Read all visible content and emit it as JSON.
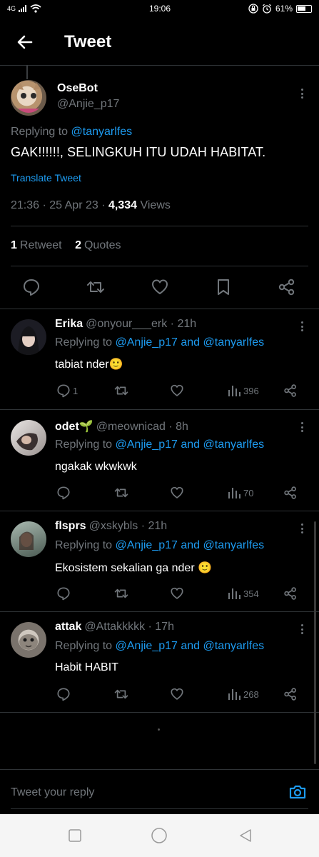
{
  "status": {
    "network": "4G",
    "time": "19:06",
    "battery": "61%"
  },
  "header": {
    "title": "Tweet"
  },
  "main_tweet": {
    "name": "OseBot",
    "handle": "@Anjie_p17",
    "replying_prefix": "Replying to ",
    "replying_to": "@tanyarlfes",
    "text": "GAK!!!!!!, SELINGKUH ITU UDAH HABITAT.",
    "translate": "Translate Tweet",
    "time": "21:36 · 25 Apr 23 · ",
    "views_count": "4,334",
    "views_label": " Views",
    "retweets_count": "1",
    "retweets_label": "Retweet",
    "quotes_count": "2",
    "quotes_label": "Quotes"
  },
  "replies": [
    {
      "name": "Erika",
      "handle": "@onyour___erk · 21h",
      "replying_prefix": "Replying to ",
      "replying_to": "@Anjie_p17 and @tanyarlfes",
      "text": "tabiat nder🙂",
      "reply_count": "1",
      "views": "396"
    },
    {
      "name": "odet🌱",
      "handle": "@meownicad · 8h",
      "replying_prefix": "Replying to ",
      "replying_to": "@Anjie_p17 and @tanyarlfes",
      "text": "ngakak wkwkwk",
      "reply_count": "",
      "views": "70"
    },
    {
      "name": "flsprs",
      "handle": "@xskybls · 21h",
      "replying_prefix": "Replying to ",
      "replying_to": "@Anjie_p17 and @tanyarlfes",
      "text": "Ekosistem sekalian ga nder 🙂",
      "reply_count": "",
      "views": "354"
    },
    {
      "name": "attak",
      "handle": "@Attakkkkk · 17h",
      "replying_prefix": "Replying to ",
      "replying_to": "@Anjie_p17 and @tanyarlfes",
      "text": "Habit HABIT",
      "reply_count": "",
      "views": "268"
    }
  ],
  "composer": {
    "placeholder": "Tweet your reply"
  },
  "icons": {
    "back": "arrow-left-icon",
    "reply": "comment-icon",
    "retweet": "retweet-icon",
    "like": "heart-icon",
    "bookmark": "bookmark-icon",
    "share": "share-icon",
    "views": "bar-chart-icon",
    "camera": "camera-icon"
  },
  "colors": {
    "accent": "#1d9bf0",
    "background": "#000000",
    "muted": "#71767b",
    "divider": "#2f3336"
  }
}
